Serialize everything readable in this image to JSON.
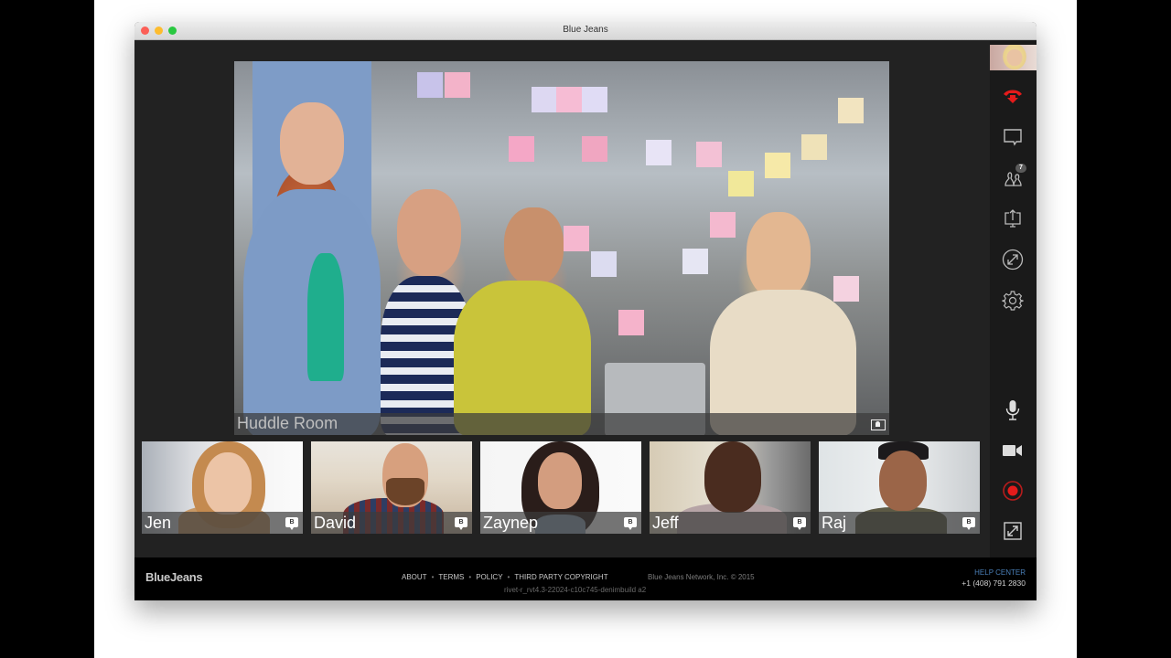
{
  "window": {
    "title": "Blue Jeans"
  },
  "main_video": {
    "caption": "Huddle Room",
    "icon": "room-system-icon"
  },
  "participants": [
    {
      "name": "Jen",
      "chat_icon_label": "B"
    },
    {
      "name": "David",
      "chat_icon_label": "B"
    },
    {
      "name": "Zaynep",
      "chat_icon_label": "B"
    },
    {
      "name": "Jeff",
      "chat_icon_label": "B"
    },
    {
      "name": "Raj",
      "chat_icon_label": "B"
    }
  ],
  "sidebar": {
    "items": [
      {
        "id": "hang-up",
        "icon": "hang-up-icon",
        "color": "#e41b1b"
      },
      {
        "id": "chat",
        "icon": "chat-icon"
      },
      {
        "id": "participants",
        "icon": "participants-icon",
        "badge": "7"
      },
      {
        "id": "share-screen",
        "icon": "share-screen-icon"
      },
      {
        "id": "switch-view",
        "icon": "switch-view-icon"
      },
      {
        "id": "settings",
        "icon": "gear-icon"
      },
      {
        "id": "mute",
        "icon": "microphone-icon"
      },
      {
        "id": "video",
        "icon": "video-camera-icon"
      },
      {
        "id": "record",
        "icon": "record-icon",
        "color": "#e41b1b"
      },
      {
        "id": "fullscreen",
        "icon": "expand-icon"
      }
    ]
  },
  "footer": {
    "logo": "BlueJeans",
    "links": [
      "ABOUT",
      "TERMS",
      "POLICY",
      "THIRD PARTY COPYRIGHT"
    ],
    "copyright": "Blue Jeans Network, Inc. © 2015",
    "build": "rivet-r_rvt4.3-22024-c10c745-denimbuild a2",
    "help_center": "HELP CENTER",
    "phone": "+1 (408) 791 2830"
  },
  "colors": {
    "accent_red": "#e41b1b",
    "help_link": "#4a7fb8"
  }
}
